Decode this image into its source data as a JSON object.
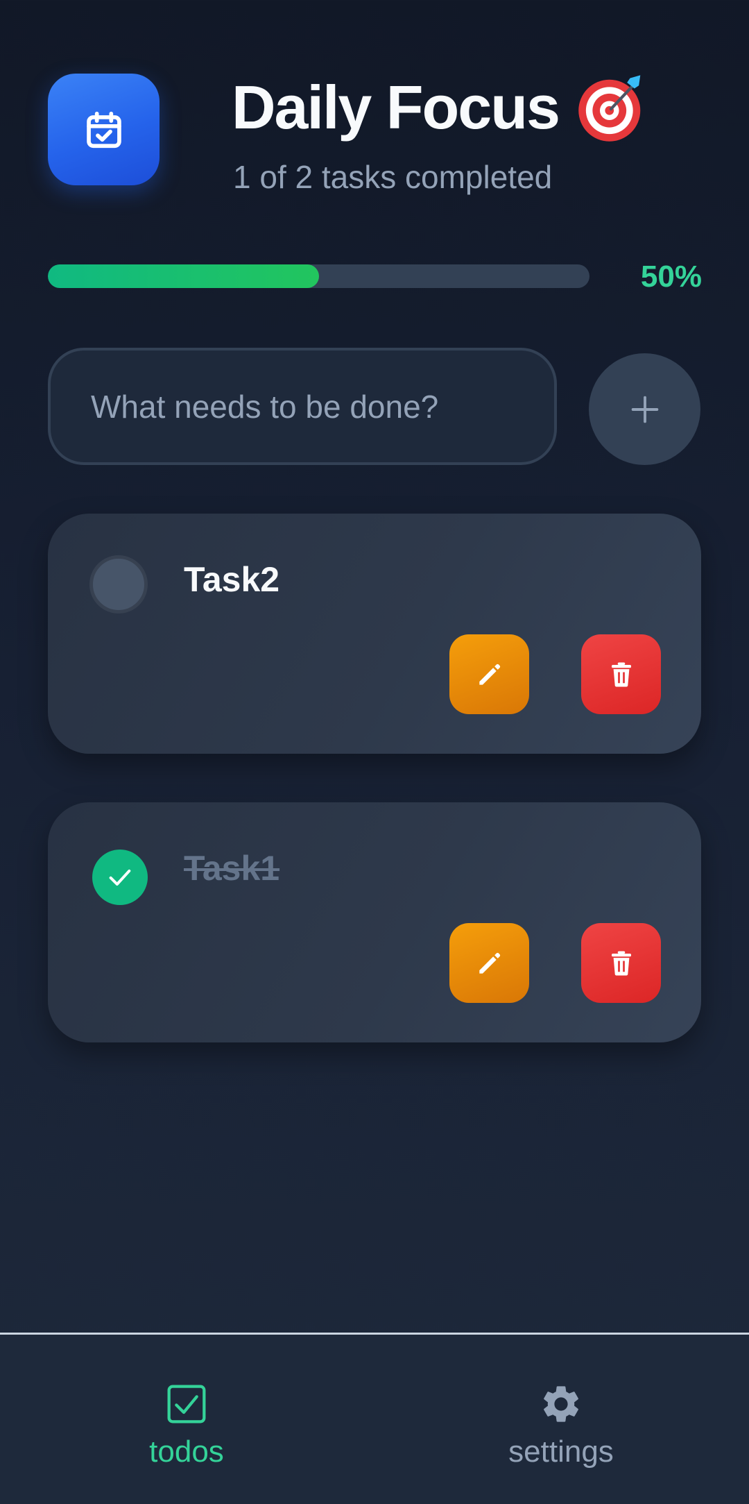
{
  "header": {
    "title": "Daily Focus",
    "title_emoji": "target-icon",
    "subtitle": "1 of 2 tasks completed",
    "app_icon": "calendar-check-icon"
  },
  "progress": {
    "percent_label": "50%",
    "value": 0.5
  },
  "new_task": {
    "placeholder": "What needs to be done?",
    "value": "",
    "add_icon": "plus-icon"
  },
  "tasks": [
    {
      "title": "Task2",
      "completed": false
    },
    {
      "title": "Task1",
      "completed": true
    }
  ],
  "task_actions": {
    "edit_icon": "pencil-icon",
    "delete_icon": "trash-icon"
  },
  "nav": {
    "items": [
      {
        "label": "todos",
        "icon": "checkbox-icon",
        "active": true
      },
      {
        "label": "settings",
        "icon": "gear-icon",
        "active": false
      }
    ]
  },
  "colors": {
    "accent": "#34d399",
    "brand": "#2563eb",
    "edit": "#f59e0b",
    "delete": "#ef4444",
    "background": "#111827"
  }
}
